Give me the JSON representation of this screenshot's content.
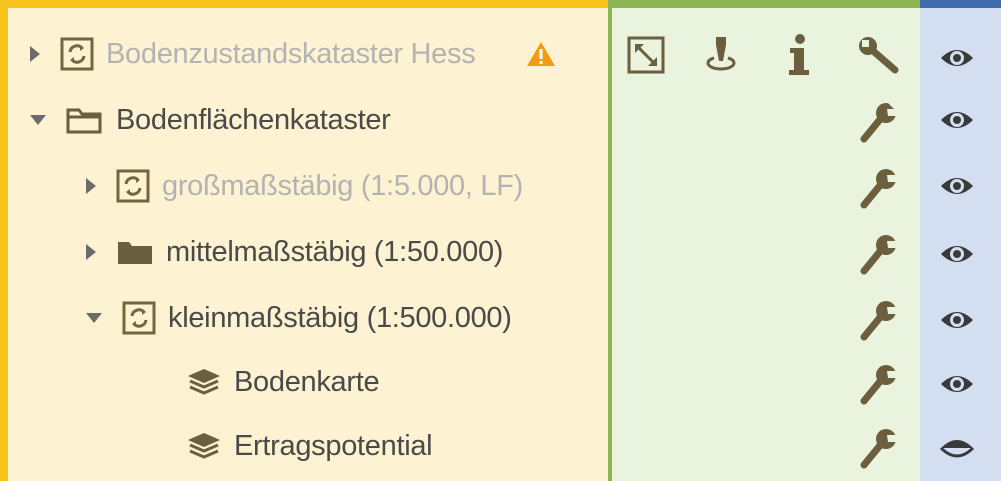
{
  "tree": {
    "items": [
      {
        "label": "Bodenzustandskataster Hess",
        "state": "collapsed",
        "icon": "refresh-layer-icon",
        "dimmed": true,
        "warning": "warning-icon"
      },
      {
        "label": "Bodenflächenkataster",
        "state": "expanded",
        "icon": "folder-open-icon",
        "dimmed": false
      },
      {
        "label": "großmaßstäbig (1:5.000, LF)",
        "state": "collapsed",
        "icon": "refresh-layer-icon",
        "dimmed": true
      },
      {
        "label": "mittelmaßstäbig (1:50.000)",
        "state": "collapsed",
        "icon": "folder-closed-icon",
        "dimmed": false
      },
      {
        "label": "kleinmaßstäbig (1:500.000)",
        "state": "expanded",
        "icon": "refresh-layer-icon",
        "dimmed": false
      },
      {
        "label": "Bodenkarte",
        "state": "leaf",
        "icon": "layers-icon",
        "dimmed": false
      },
      {
        "label": "Ertragspotential",
        "state": "leaf",
        "icon": "layers-icon",
        "dimmed": false
      }
    ]
  },
  "tools": {
    "header_icons": [
      "zoom-extent-icon",
      "location-pin-icon",
      "info-icon",
      "wrench-icon"
    ],
    "row_icon": "wrench-icon"
  },
  "visibility": {
    "icons": [
      "eye-icon",
      "eye-icon",
      "eye-icon",
      "eye-icon",
      "eye-icon",
      "eye-icon",
      "eye-half-icon"
    ]
  },
  "colors": {
    "tree_panel_bg": "#fdf2d1",
    "tree_panel_border": "#f6c21c",
    "tools_panel_bg": "#eaf3de",
    "tools_panel_border": "#8db553",
    "vis_panel_bg": "#d3dff0",
    "vis_panel_border": "#3f6bab",
    "icon_color": "#75663e",
    "warning": "#f39c12"
  }
}
